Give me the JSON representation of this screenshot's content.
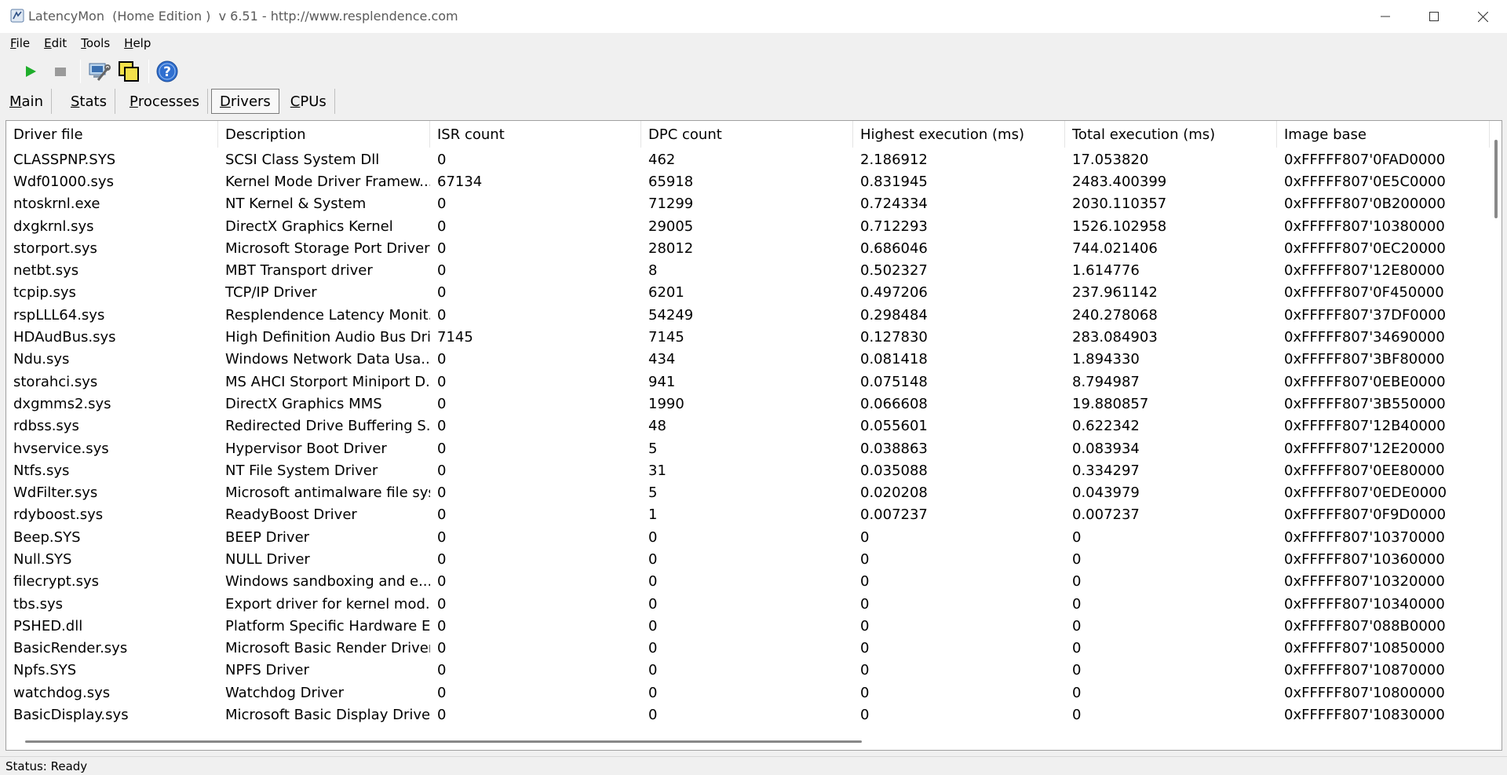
{
  "window": {
    "title": "LatencyMon  (Home Edition )  v 6.51 - http://www.resplendence.com"
  },
  "menu": [
    {
      "key": "F",
      "rest": "ile"
    },
    {
      "key": "E",
      "rest": "dit"
    },
    {
      "key": "T",
      "rest": "ools"
    },
    {
      "key": "H",
      "rest": "elp"
    }
  ],
  "toolbar": {
    "icons": [
      "play-icon",
      "stop-icon",
      "computer-wrench-icon",
      "windows-icon",
      "help-icon"
    ]
  },
  "tabs": [
    {
      "key": "M",
      "rest": "ain"
    },
    {
      "key": "S",
      "rest": "tats"
    },
    {
      "key": "P",
      "rest": "rocesses"
    },
    {
      "key": "D",
      "rest": "rivers"
    },
    {
      "key": "C",
      "rest": "PUs"
    }
  ],
  "active_tab": "Drivers",
  "table": {
    "columns": [
      "Driver file",
      "Description",
      "ISR count",
      "DPC count",
      "Highest execution (ms)",
      "Total execution (ms)",
      "Image base"
    ],
    "rows": [
      [
        "CLASSPNP.SYS",
        "SCSI Class System Dll",
        "0",
        "462",
        "2.186912",
        "17.053820",
        "0xFFFFF807'0FAD0000"
      ],
      [
        "Wdf01000.sys",
        "Kernel Mode Driver Framew...",
        "67134",
        "65918",
        "0.831945",
        "2483.400399",
        "0xFFFFF807'0E5C0000"
      ],
      [
        "ntoskrnl.exe",
        "NT Kernel & System",
        "0",
        "71299",
        "0.724334",
        "2030.110357",
        "0xFFFFF807'0B200000"
      ],
      [
        "dxgkrnl.sys",
        "DirectX Graphics Kernel",
        "0",
        "29005",
        "0.712293",
        "1526.102958",
        "0xFFFFF807'10380000"
      ],
      [
        "storport.sys",
        "Microsoft Storage Port Driver",
        "0",
        "28012",
        "0.686046",
        "744.021406",
        "0xFFFFF807'0EC20000"
      ],
      [
        "netbt.sys",
        "MBT Transport driver",
        "0",
        "8",
        "0.502327",
        "1.614776",
        "0xFFFFF807'12E80000"
      ],
      [
        "tcpip.sys",
        "TCP/IP Driver",
        "0",
        "6201",
        "0.497206",
        "237.961142",
        "0xFFFFF807'0F450000"
      ],
      [
        "rspLLL64.sys",
        "Resplendence Latency Monit...",
        "0",
        "54249",
        "0.298484",
        "240.278068",
        "0xFFFFF807'37DF0000"
      ],
      [
        "HDAudBus.sys",
        "High Definition Audio Bus Dri...",
        "7145",
        "7145",
        "0.127830",
        "283.084903",
        "0xFFFFF807'34690000"
      ],
      [
        "Ndu.sys",
        "Windows Network Data Usa...",
        "0",
        "434",
        "0.081418",
        "1.894330",
        "0xFFFFF807'3BF80000"
      ],
      [
        "storahci.sys",
        "MS AHCI Storport Miniport D...",
        "0",
        "941",
        "0.075148",
        "8.794987",
        "0xFFFFF807'0EBE0000"
      ],
      [
        "dxgmms2.sys",
        "DirectX Graphics MMS",
        "0",
        "1990",
        "0.066608",
        "19.880857",
        "0xFFFFF807'3B550000"
      ],
      [
        "rdbss.sys",
        "Redirected Drive Buffering S...",
        "0",
        "48",
        "0.055601",
        "0.622342",
        "0xFFFFF807'12B40000"
      ],
      [
        "hvservice.sys",
        "Hypervisor Boot Driver",
        "0",
        "5",
        "0.038863",
        "0.083934",
        "0xFFFFF807'12E20000"
      ],
      [
        "Ntfs.sys",
        "NT File System Driver",
        "0",
        "31",
        "0.035088",
        "0.334297",
        "0xFFFFF807'0EE80000"
      ],
      [
        "WdFilter.sys",
        "Microsoft antimalware file sys...",
        "0",
        "5",
        "0.020208",
        "0.043979",
        "0xFFFFF807'0EDE0000"
      ],
      [
        "rdyboost.sys",
        "ReadyBoost Driver",
        "0",
        "1",
        "0.007237",
        "0.007237",
        "0xFFFFF807'0F9D0000"
      ],
      [
        "Beep.SYS",
        "BEEP Driver",
        "0",
        "0",
        "0",
        "0",
        "0xFFFFF807'10370000"
      ],
      [
        "Null.SYS",
        "NULL Driver",
        "0",
        "0",
        "0",
        "0",
        "0xFFFFF807'10360000"
      ],
      [
        "filecrypt.sys",
        "Windows sandboxing and e...",
        "0",
        "0",
        "0",
        "0",
        "0xFFFFF807'10320000"
      ],
      [
        "tbs.sys",
        "Export driver for kernel mod...",
        "0",
        "0",
        "0",
        "0",
        "0xFFFFF807'10340000"
      ],
      [
        "PSHED.dll",
        "Platform Specific Hardware E...",
        "0",
        "0",
        "0",
        "0",
        "0xFFFFF807'088B0000"
      ],
      [
        "BasicRender.sys",
        "Microsoft Basic Render Driver",
        "0",
        "0",
        "0",
        "0",
        "0xFFFFF807'10850000"
      ],
      [
        "Npfs.SYS",
        "NPFS Driver",
        "0",
        "0",
        "0",
        "0",
        "0xFFFFF807'10870000"
      ],
      [
        "watchdog.sys",
        "Watchdog Driver",
        "0",
        "0",
        "0",
        "0",
        "0xFFFFF807'10800000"
      ],
      [
        "BasicDisplay.sys",
        "Microsoft Basic Display Driver",
        "0",
        "0",
        "0",
        "0",
        "0xFFFFF807'10830000"
      ]
    ]
  },
  "status": "Status: Ready"
}
